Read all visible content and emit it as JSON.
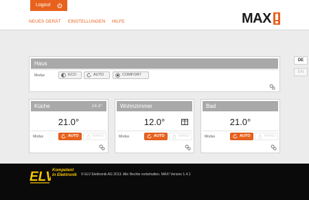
{
  "header": {
    "logout_label": "Logout",
    "nav": [
      "NEUES GERÄT",
      "EINSTELLUNGEN",
      "HILFE"
    ],
    "logo": "MAX"
  },
  "languages": [
    "DE",
    "EN"
  ],
  "house": {
    "title": "Haus",
    "modus_label": "Modus",
    "modes": [
      "ECO",
      "AUTO",
      "COMFORT"
    ]
  },
  "rooms": [
    {
      "title": "Küche",
      "current_temp": "24.4°",
      "setpoint": "21.0°",
      "modus_label": "Modus",
      "active_mode": "AUTO",
      "manual_mode": "MANU"
    },
    {
      "title": "Wohnzimmer",
      "current_temp": "",
      "setpoint": "12.0°",
      "modus_label": "Modus",
      "active_mode": "AUTO",
      "manual_mode": "MANU",
      "window_open": true
    },
    {
      "title": "Bad",
      "current_temp": "",
      "setpoint": "21.0°",
      "modus_label": "Modus",
      "active_mode": "AUTO",
      "manual_mode": "MANU"
    }
  ],
  "footer": {
    "brand": "ELV",
    "slogan_line1": "Kompetent",
    "slogan_line2": "in Elektronik",
    "copyright": "© ELV Elektronik AG 2013. Alle Rechte vorbehalten. MAX! Version 1.4.1"
  },
  "colors": {
    "accent": "#e8621e",
    "card_header": "#a9a9a9",
    "footer_bg": "#0a0a0a",
    "slogan": "#f5c400"
  },
  "icons": [
    "power-icon",
    "gear-icon",
    "eco-icon",
    "auto-icon",
    "comfort-icon",
    "window-icon",
    "hand-icon"
  ]
}
